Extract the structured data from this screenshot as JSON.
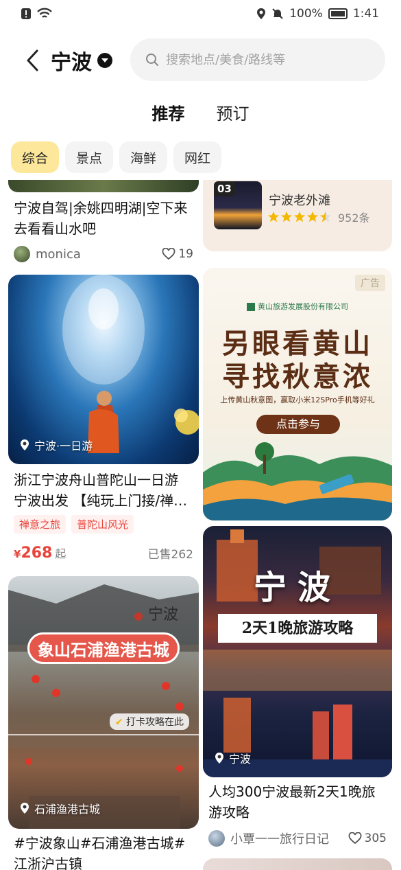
{
  "status": {
    "time": "1:41",
    "battery": "100%"
  },
  "header": {
    "city": "宁波",
    "search_placeholder": "搜索地点/美食/路线等"
  },
  "tabs": [
    {
      "label": "推荐",
      "active": true
    },
    {
      "label": "预订",
      "active": false
    }
  ],
  "chips": [
    {
      "label": "综合",
      "active": true
    },
    {
      "label": "景点"
    },
    {
      "label": "海鲜"
    },
    {
      "label": "网红"
    }
  ],
  "feed": {
    "left": [
      {
        "title": "宁波自驾|余姚四明湖|空下来去看看山水吧",
        "author": "monica",
        "likes": "19"
      },
      {
        "location": "宁波·一日游",
        "title": "浙江宁波舟山普陀山一日游 宁波出发 【纯玩上门接/禅…",
        "tags": [
          "禅意之旅",
          "普陀山风光"
        ],
        "price_symbol": "¥",
        "price": "268",
        "price_suffix": "起",
        "sold": "已售262"
      },
      {
        "image_text_top": "宁波",
        "image_title": "象山石浦渔港古城",
        "image_badge": "打卡攻略在此",
        "location": "石浦渔港古城",
        "title": "#宁波象山#石浦渔港古城#江浙沪古镇"
      }
    ],
    "right": [
      {
        "rank": "03",
        "name": "宁波老外滩",
        "stars": 4.5,
        "count": "952条"
      },
      {
        "ad_label": "广告",
        "company": "黄山旅游发展股份有限公司",
        "headline1": "另眼看黄山",
        "headline2": "寻找秋意浓",
        "subline": "上传黄山秋意图，赢取小米12SPro手机等好礼",
        "cta": "点击参与"
      },
      {
        "image_text1": "宁波",
        "image_text2": "2天1晚旅游攻略",
        "location": "宁波",
        "title": "人均300宁波最新2天1晚旅游攻略",
        "author": "小覃一一旅行日记",
        "likes": "305"
      }
    ]
  },
  "colors": {
    "accent": "#ffd233",
    "price": "#e8443b",
    "chip_active": "#fde79a"
  }
}
